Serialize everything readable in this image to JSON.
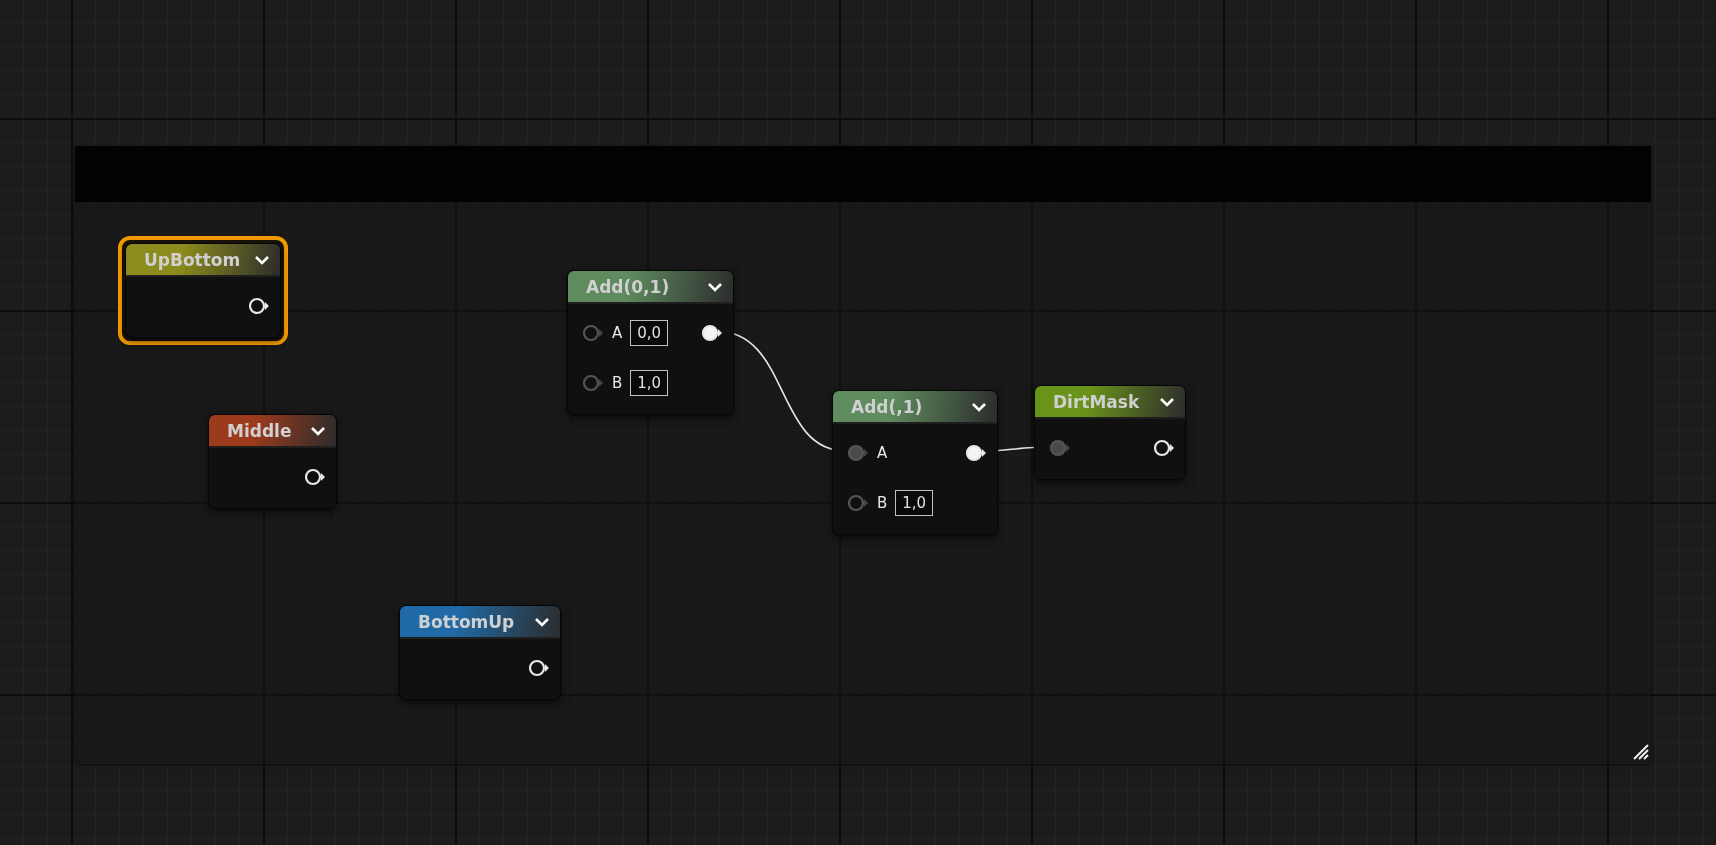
{
  "nodes": [
    {
      "title": "UpBottom",
      "color": "#8c8c1c",
      "selected": true,
      "rows": [
        {
          "output": {
            "connected": false
          }
        }
      ]
    },
    {
      "title": "Middle",
      "color": "#9c3a1c",
      "selected": false,
      "rows": [
        {
          "output": {
            "connected": false
          }
        }
      ]
    },
    {
      "title": "BottomUp",
      "color": "#1f6aa6",
      "selected": false,
      "rows": [
        {
          "output": {
            "connected": false
          }
        }
      ]
    },
    {
      "title": "Add(0,1)",
      "color": "#5f8c5f",
      "selected": false,
      "rows": [
        {
          "input": {
            "connected": false
          },
          "label": "A",
          "value": "0,0",
          "output": {
            "connected": true
          }
        },
        {
          "input": {
            "connected": false
          },
          "label": "B",
          "value": "1,0"
        }
      ]
    },
    {
      "title": "Add(,1)",
      "color": "#5f8c5f",
      "selected": false,
      "rows": [
        {
          "input": {
            "connected": true
          },
          "label": "A",
          "output": {
            "connected": true
          }
        },
        {
          "input": {
            "connected": false
          },
          "label": "B",
          "value": "1,0"
        }
      ]
    },
    {
      "title": "DirtMask",
      "color": "#6a931a",
      "selected": false,
      "rows": [
        {
          "input": {
            "connected": true
          },
          "output": {
            "connected": false
          }
        }
      ]
    }
  ]
}
